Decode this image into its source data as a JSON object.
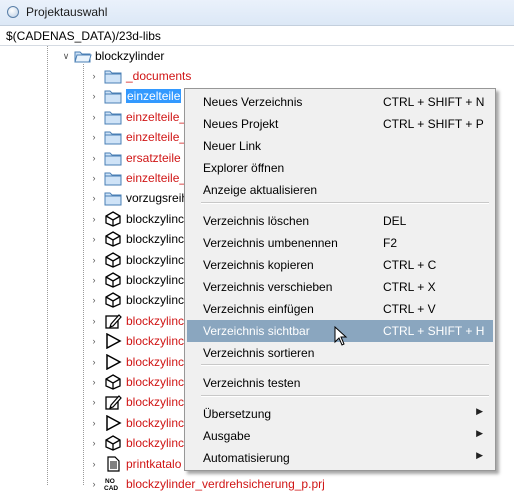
{
  "window": {
    "title": "Projektauswahl"
  },
  "path": {
    "value": "$(CADENAS_DATA)/23d-libs"
  },
  "tree": {
    "parent": {
      "label": "blockzylinder",
      "icon": "folder-open-icon"
    },
    "items": [
      {
        "label": "_documents",
        "color": "red",
        "icon": "folder-icon"
      },
      {
        "label": "einzelteile",
        "color": "selected",
        "icon": "folder-icon"
      },
      {
        "label": "einzelteile_",
        "color": "red",
        "icon": "folder-icon"
      },
      {
        "label": "einzelteile_",
        "color": "red",
        "icon": "folder-icon"
      },
      {
        "label": "ersatzteile",
        "color": "red",
        "icon": "folder-icon"
      },
      {
        "label": "einzelteile_",
        "color": "red",
        "icon": "folder-icon"
      },
      {
        "label": "vorzugsreih",
        "color": "black",
        "icon": "folder-icon"
      },
      {
        "label": "blockzylinc",
        "color": "black",
        "icon": "cube-icon"
      },
      {
        "label": "blockzylinc",
        "color": "black",
        "icon": "cube-icon"
      },
      {
        "label": "blockzylinc",
        "color": "black",
        "icon": "cube-icon"
      },
      {
        "label": "blockzylinc",
        "color": "black",
        "icon": "cube-icon"
      },
      {
        "label": "blockzylinc",
        "color": "black",
        "icon": "cube-icon"
      },
      {
        "label": "blockzylinc",
        "color": "red",
        "icon": "edit-icon"
      },
      {
        "label": "blockzylinc",
        "color": "red",
        "icon": "triangle-icon"
      },
      {
        "label": "blockzylinc",
        "color": "red",
        "icon": "triangle-icon"
      },
      {
        "label": "blockzylinc",
        "color": "red",
        "icon": "cube-icon"
      },
      {
        "label": "blockzylinc",
        "color": "red",
        "icon": "edit-icon"
      },
      {
        "label": "blockzylinc",
        "color": "red",
        "icon": "triangle-icon"
      },
      {
        "label": "blockzylinc",
        "color": "red",
        "icon": "cube-icon"
      },
      {
        "label": "printkatalo",
        "color": "red",
        "icon": "document-icon"
      },
      {
        "label": "blockzylinder_verdrehsicherung_p.prj",
        "color": "red",
        "icon": "no-cad-icon"
      }
    ]
  },
  "context_menu": {
    "items": [
      {
        "label": "Neues Verzeichnis",
        "shortcut": "CTRL + SHIFT + N"
      },
      {
        "label": "Neues Projekt",
        "shortcut": "CTRL + SHIFT + P"
      },
      {
        "label": "Neuer Link",
        "shortcut": ""
      },
      {
        "label": "Explorer öffnen",
        "shortcut": ""
      },
      {
        "label": "Anzeige aktualisieren",
        "shortcut": ""
      },
      {
        "label": "Verzeichnis löschen",
        "shortcut": "DEL"
      },
      {
        "label": "Verzeichnis umbenennen",
        "shortcut": "F2"
      },
      {
        "label": "Verzeichnis kopieren",
        "shortcut": "CTRL + C"
      },
      {
        "label": "Verzeichnis verschieben",
        "shortcut": "CTRL + X"
      },
      {
        "label": "Verzeichnis einfügen",
        "shortcut": "CTRL + V"
      },
      {
        "label": "Verzeichnis sichtbar",
        "shortcut": "CTRL + SHIFT + H",
        "highlighted": true
      },
      {
        "label": "Verzeichnis sortieren",
        "shortcut": ""
      },
      {
        "label": "Verzeichnis testen",
        "shortcut": ""
      },
      {
        "label": "Übersetzung",
        "shortcut": "",
        "submenu": true
      },
      {
        "label": "Ausgabe",
        "shortcut": "",
        "submenu": true
      },
      {
        "label": "Automatisierung",
        "shortcut": "",
        "submenu": true
      }
    ]
  },
  "colors": {
    "red_text": "#d01515",
    "selection": "#3399ff",
    "menu_highlight": "#8aa6bf",
    "menu_bg": "#f0f0f0"
  }
}
